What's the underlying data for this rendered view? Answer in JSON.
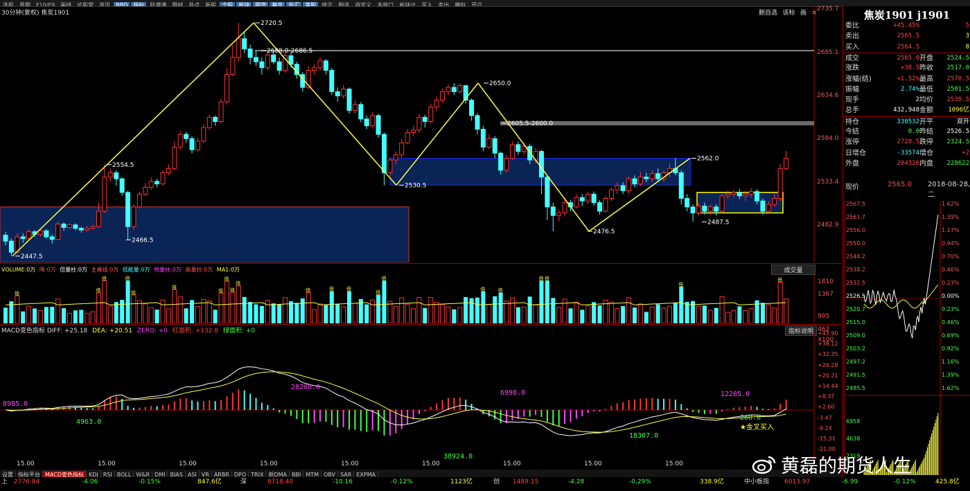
{
  "menu": [
    "选股",
    "周期",
    "F10/F9",
    "画线",
    "论股堂",
    "资讯",
    "BBD",
    "指标",
    "陆港通",
    "题材",
    "热点",
    "新股",
    "个股",
    "板块",
    "期货",
    "基金",
    "外汇",
    "美股",
    "修正",
    "删选",
    "自定义",
    "多窗口",
    "板块计",
    "买入",
    "卖出",
    "模拟",
    "开户"
  ],
  "main_chart": {
    "title": "30分钟(复权)  焦炭1901",
    "controls": [
      "删自选",
      "该标",
      "画",
      "×"
    ],
    "y_labels": [
      "2735.7",
      "2685.1",
      "2634.6",
      "2584.0",
      "2533.4",
      "2482.9"
    ],
    "annotations": [
      "2720.5",
      "2688.0-2686.5",
      "2650.0",
      "2605.5-2600.0",
      "2554.5",
      "2530.5",
      "2466.5",
      "2447.5",
      "2562.0",
      "2487.5",
      "2476.5"
    ]
  },
  "volume_panel": {
    "header_items": [
      "VOLUME:0万",
      "降:0万",
      "倍量柱:0万",
      "主峰线:0万",
      "低能量:0万",
      "地量柱:0万",
      "高量柱:0万",
      "MA1:0万"
    ],
    "right_button": "成交量",
    "y_labels": [
      "1810",
      "1367",
      "905",
      "462",
      "X100"
    ],
    "bar_tag": "倍"
  },
  "macd_panel": {
    "header": [
      "MACD变色指标 DIFF: +25.18",
      "DEA: +20.51",
      "ZERO: +0",
      "红面积: +132.8",
      "绿面积: +0"
    ],
    "right_button": "指标说明",
    "y_labels": [
      "+43.90",
      "+38.12",
      "+32.35",
      "+26.28",
      "+20.21",
      "+14.44",
      "+8.37",
      "+2.60",
      "-3.47",
      "-9.24",
      "-15.31",
      "-21.00"
    ],
    "area_labels": [
      "8985.0",
      "4963.0",
      "28208.0",
      "6998.0",
      "12285.0",
      "260.0",
      "18307.0",
      "38924.0"
    ],
    "cross_label": "★金叉买入"
  },
  "x_axis": [
    "15.00",
    "15.00",
    "15.00",
    "15.00",
    "15.00",
    "15.00",
    "15.00",
    "15.00",
    "15.00"
  ],
  "tabs": [
    "设置",
    "指标平台",
    "MACD变色指标",
    "KDJ",
    "RSI",
    "BOLL",
    "W&R",
    "DMI",
    "BIAS",
    "ASI",
    "VR",
    "ARBR",
    "DPO",
    "TRIX",
    "新DMA",
    "BBI",
    "MTM",
    "OBV",
    "SAR",
    "EXPMA"
  ],
  "status": [
    {
      "t": "上",
      "c": "#ddd"
    },
    {
      "t": "2776.84",
      "c": "#ff4444"
    },
    {
      "t": "-4.06",
      "c": "#44ff44"
    },
    {
      "t": "-0.15%",
      "c": "#44ff44"
    },
    {
      "t": "847.6亿",
      "c": "#ffff44"
    },
    {
      "t": "深",
      "c": "#ddd"
    },
    {
      "t": "8718.40",
      "c": "#ff4444"
    },
    {
      "t": "-10.16",
      "c": "#44ff44"
    },
    {
      "t": "-0.12%",
      "c": "#44ff44"
    },
    {
      "t": "1123亿",
      "c": "#ffff44"
    },
    {
      "t": "创",
      "c": "#ddd"
    },
    {
      "t": "1489.15",
      "c": "#ff4444"
    },
    {
      "t": "-4.28",
      "c": "#44ff44"
    },
    {
      "t": "-0.29%",
      "c": "#44ff44"
    },
    {
      "t": "338.9亿",
      "c": "#ffff44"
    },
    {
      "t": "中小板指",
      "c": "#ddd"
    },
    {
      "t": "6013.97",
      "c": "#ff4444"
    },
    {
      "t": "-6.99",
      "c": "#44ff44"
    },
    {
      "t": "-0.12%",
      "c": "#44ff44"
    },
    {
      "t": "425.8亿",
      "c": "#ffff44"
    }
  ],
  "quote": {
    "title": "焦炭1901 j1901",
    "rows": [
      {
        "k": "委比",
        "v": "+45.45%",
        "k2": "",
        "v2": "5",
        "vc": "#ff4444",
        "v2c": "#ff4444"
      },
      {
        "k": "卖出",
        "v": "2565.5",
        "k2": "",
        "v2": "3",
        "vc": "#ff4444",
        "v2c": "#ffff44"
      },
      {
        "k": "买入",
        "v": "2564.5",
        "k2": "",
        "v2": "8",
        "vc": "#ff4444",
        "v2c": "#ffff44"
      },
      {
        "k": "成交",
        "v": "2565.0",
        "k2": "开盘",
        "v2": "2524.5",
        "vc": "#ff4444",
        "v2c": "#44ff44"
      },
      {
        "k": "涨跌",
        "v": "+38.5",
        "k2": "昨收",
        "v2": "2517.0",
        "vc": "#ff4444",
        "v2c": "#44ff44"
      },
      {
        "k": "涨幅(结)",
        "v": "+1.52%",
        "k2": "最高",
        "v2": "2570.5",
        "vc": "#ff4444",
        "v2c": "#ff4444"
      },
      {
        "k": "振幅",
        "v": "2.74%",
        "k2": "最低",
        "v2": "2501.5",
        "vc": "#44ffff",
        "v2c": "#44ff44"
      },
      {
        "k": "现手",
        "v": "2",
        "k2": "均价",
        "v2": "2530.5",
        "vc": "#ffffff",
        "v2c": "#ff4444"
      },
      {
        "k": "总手",
        "v": "432,948",
        "k2": "金额",
        "v2": "1096亿",
        "vc": "#ffffff",
        "v2c": "#ffff44"
      },
      {
        "k": "持仓",
        "v": "330532",
        "k2": "开平",
        "v2": "双开",
        "vc": "#44ffff",
        "v2c": "#ffffff"
      },
      {
        "k": "今结",
        "v": "0.0",
        "k2": "昨结",
        "v2": "2526.5",
        "vc": "#44ff44",
        "v2c": "#ffffff"
      },
      {
        "k": "涨停",
        "v": "2728.5",
        "k2": "跌停",
        "v2": "2324.5",
        "vc": "#ff4444",
        "v2c": "#44ff44"
      },
      {
        "k": "日增仓",
        "v": "-33574",
        "k2": "增仓",
        "v2": "+2",
        "vc": "#44ffff",
        "v2c": "#ff4444"
      },
      {
        "k": "外盘",
        "v": "204326",
        "k2": "内盘",
        "v2": "228622",
        "vc": "#ff4444",
        "v2c": "#44ff44"
      }
    ],
    "price_label": "现价",
    "price": "2565.0",
    "date": "2018-08-28,二",
    "mini_left": [
      "2567.5",
      "2561.7",
      "2556.0",
      "2550.0",
      "2544.2",
      "2538.2",
      "2532.5",
      "2526.5",
      "2520.7",
      "2515.0",
      "2509.0",
      "2503.2",
      "2497.2",
      "2491.5",
      "2485.5",
      "6958",
      "4638",
      "2319"
    ],
    "mini_right": [
      "1.62%",
      "1.39%",
      "1.17%",
      "0.94%",
      "0.70%",
      "0.46%",
      "0.23%",
      "0.00%",
      "0.23%",
      "0.46%",
      "0.69%",
      "0.92%",
      "1.16%",
      "1.39%",
      "1.62%"
    ]
  },
  "watermark": "黄磊的期货人生",
  "candles": [
    [
      2472,
      2465,
      2476,
      2460
    ],
    [
      2465,
      2452,
      2468,
      2447.5
    ],
    [
      2452,
      2470,
      2474,
      2450
    ],
    [
      2470,
      2468,
      2474,
      2463
    ],
    [
      2468,
      2476,
      2479,
      2466
    ],
    [
      2476,
      2473,
      2478,
      2470
    ],
    [
      2473,
      2477,
      2480,
      2470
    ],
    [
      2477,
      2470,
      2479,
      2468
    ],
    [
      2470,
      2467,
      2473,
      2462
    ],
    [
      2467,
      2485,
      2488,
      2466
    ],
    [
      2485,
      2481,
      2487,
      2477
    ],
    [
      2481,
      2484,
      2486,
      2479
    ],
    [
      2484,
      2480,
      2486,
      2478
    ],
    [
      2480,
      2478,
      2482,
      2475
    ],
    [
      2478,
      2480,
      2483,
      2476
    ],
    [
      2480,
      2482,
      2484,
      2478
    ],
    [
      2482,
      2500,
      2510,
      2480
    ],
    [
      2500,
      2540,
      2554.5,
      2498
    ],
    [
      2540,
      2545,
      2550,
      2535
    ],
    [
      2545,
      2538,
      2548,
      2530
    ],
    [
      2538,
      2522,
      2540,
      2518
    ],
    [
      2522,
      2482,
      2524,
      2466.5
    ],
    [
      2482,
      2505,
      2508,
      2478
    ],
    [
      2505,
      2520,
      2523,
      2503
    ],
    [
      2520,
      2528,
      2533,
      2518
    ],
    [
      2528,
      2535,
      2540,
      2525
    ],
    [
      2535,
      2532,
      2538,
      2528
    ],
    [
      2532,
      2545,
      2548,
      2530
    ],
    [
      2545,
      2550,
      2555,
      2542
    ],
    [
      2550,
      2575,
      2582,
      2548
    ],
    [
      2575,
      2590,
      2594,
      2572
    ],
    [
      2590,
      2585,
      2593,
      2580
    ],
    [
      2585,
      2572,
      2588,
      2568
    ],
    [
      2572,
      2582,
      2586,
      2570
    ],
    [
      2582,
      2598,
      2602,
      2580
    ],
    [
      2598,
      2610,
      2613,
      2595
    ],
    [
      2610,
      2605,
      2612,
      2600
    ],
    [
      2605,
      2628,
      2632,
      2603
    ],
    [
      2628,
      2660,
      2668,
      2625
    ],
    [
      2660,
      2680,
      2695,
      2658
    ],
    [
      2680,
      2702,
      2720.5,
      2675
    ],
    [
      2702,
      2690,
      2710,
      2685
    ],
    [
      2690,
      2680,
      2695,
      2672
    ],
    [
      2680,
      2675,
      2688,
      2670
    ],
    [
      2675,
      2668,
      2680,
      2660
    ],
    [
      2668,
      2683,
      2686,
      2665
    ],
    [
      2683,
      2675,
      2688,
      2672
    ],
    [
      2675,
      2665,
      2680,
      2660
    ],
    [
      2665,
      2682,
      2686,
      2662
    ],
    [
      2682,
      2672,
      2686,
      2668
    ],
    [
      2672,
      2660,
      2675,
      2655
    ],
    [
      2660,
      2645,
      2663,
      2640
    ],
    [
      2645,
      2665,
      2670,
      2643
    ],
    [
      2665,
      2668,
      2672,
      2660
    ],
    [
      2668,
      2676,
      2680,
      2664
    ],
    [
      2676,
      2665,
      2678,
      2660
    ],
    [
      2665,
      2640,
      2668,
      2636
    ],
    [
      2640,
      2635,
      2645,
      2628
    ],
    [
      2635,
      2643,
      2648,
      2632
    ],
    [
      2643,
      2618,
      2645,
      2614
    ],
    [
      2618,
      2625,
      2630,
      2614
    ],
    [
      2625,
      2608,
      2628,
      2604
    ],
    [
      2608,
      2600,
      2612,
      2596
    ],
    [
      2600,
      2612,
      2616,
      2598
    ],
    [
      2612,
      2590,
      2614,
      2586
    ],
    [
      2590,
      2545,
      2592,
      2530.5
    ],
    [
      2545,
      2560,
      2563,
      2540
    ],
    [
      2560,
      2566,
      2570,
      2555
    ],
    [
      2566,
      2580,
      2585,
      2562
    ],
    [
      2580,
      2592,
      2596,
      2578
    ],
    [
      2592,
      2595,
      2600,
      2588
    ],
    [
      2595,
      2610,
      2614,
      2592
    ],
    [
      2610,
      2605,
      2613,
      2598
    ],
    [
      2605,
      2622,
      2626,
      2603
    ],
    [
      2622,
      2630,
      2634,
      2618
    ],
    [
      2630,
      2640,
      2644,
      2627
    ],
    [
      2640,
      2645,
      2648,
      2636
    ],
    [
      2645,
      2640,
      2650,
      2636
    ],
    [
      2640,
      2647,
      2650,
      2638
    ],
    [
      2647,
      2630,
      2648,
      2626
    ],
    [
      2630,
      2612,
      2632,
      2606
    ],
    [
      2612,
      2596,
      2615,
      2590
    ],
    [
      2596,
      2575,
      2600,
      2570
    ],
    [
      2575,
      2585,
      2590,
      2572
    ],
    [
      2585,
      2568,
      2588,
      2562
    ],
    [
      2568,
      2548,
      2570,
      2543
    ],
    [
      2548,
      2562,
      2566,
      2545
    ],
    [
      2562,
      2578,
      2582,
      2560
    ],
    [
      2578,
      2570,
      2582,
      2566
    ],
    [
      2570,
      2576,
      2580,
      2566
    ],
    [
      2576,
      2560,
      2579,
      2555
    ],
    [
      2560,
      2570,
      2574,
      2556
    ],
    [
      2570,
      2540,
      2572,
      2520
    ],
    [
      2540,
      2505,
      2542,
      2490
    ],
    [
      2505,
      2495,
      2510,
      2476.5
    ],
    [
      2495,
      2498,
      2502,
      2488
    ],
    [
      2498,
      2510,
      2514,
      2494
    ],
    [
      2510,
      2505,
      2513,
      2500
    ],
    [
      2505,
      2516,
      2520,
      2503
    ],
    [
      2516,
      2512,
      2520,
      2506
    ],
    [
      2512,
      2520,
      2523,
      2508
    ],
    [
      2520,
      2510,
      2523,
      2506
    ],
    [
      2510,
      2500,
      2513,
      2496
    ],
    [
      2500,
      2515,
      2518,
      2498
    ],
    [
      2515,
      2525,
      2528,
      2512
    ],
    [
      2525,
      2530,
      2534,
      2520
    ],
    [
      2530,
      2524,
      2534,
      2520
    ],
    [
      2524,
      2538,
      2541,
      2520
    ],
    [
      2538,
      2532,
      2542,
      2528
    ],
    [
      2532,
      2540,
      2546,
      2530
    ],
    [
      2540,
      2538,
      2545,
      2534
    ],
    [
      2538,
      2544,
      2548,
      2534
    ],
    [
      2544,
      2538,
      2550,
      2534
    ],
    [
      2538,
      2545,
      2548,
      2534
    ],
    [
      2545,
      2550,
      2556,
      2540
    ],
    [
      2550,
      2545,
      2562,
      2542
    ],
    [
      2545,
      2515,
      2548,
      2508
    ],
    [
      2515,
      2505,
      2520,
      2500
    ],
    [
      2505,
      2498,
      2508,
      2487.5
    ],
    [
      2498,
      2506,
      2510,
      2495
    ],
    [
      2506,
      2500,
      2510,
      2496
    ],
    [
      2500,
      2505,
      2508,
      2496
    ],
    [
      2505,
      2500,
      2508,
      2495
    ],
    [
      2500,
      2518,
      2520,
      2498
    ],
    [
      2518,
      2520,
      2524,
      2515
    ],
    [
      2520,
      2522,
      2525,
      2516
    ],
    [
      2522,
      2518,
      2526,
      2514
    ],
    [
      2518,
      2520,
      2524,
      2512
    ],
    [
      2520,
      2523,
      2527,
      2516
    ],
    [
      2523,
      2512,
      2526,
      2508
    ],
    [
      2512,
      2500,
      2515,
      2496
    ],
    [
      2500,
      2508,
      2512,
      2498
    ],
    [
      2508,
      2515,
      2520,
      2505
    ],
    [
      2515,
      2550,
      2555,
      2512
    ],
    [
      2550,
      2562,
      2570.5,
      2548
    ]
  ]
}
